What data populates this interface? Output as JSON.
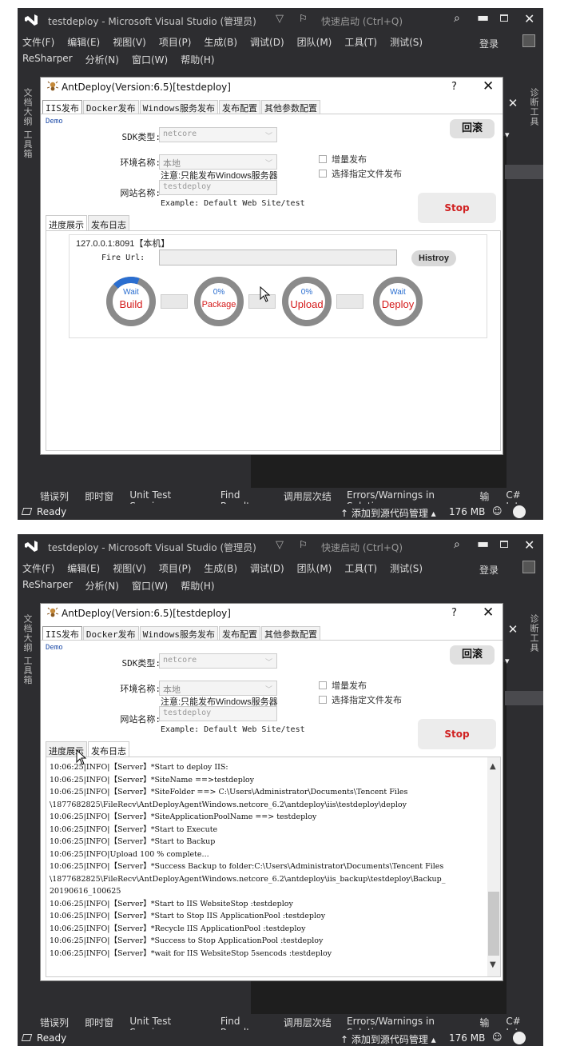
{
  "vs": {
    "title": "testdeploy - Microsoft Visual Studio (管理员)",
    "quick_launch": "快速启动 (Ctrl+Q)",
    "menu1": [
      "文件(F)",
      "编辑(E)",
      "视图(V)",
      "项目(P)",
      "生成(B)",
      "调试(D)",
      "团队(M)",
      "工具(T)",
      "测试(S)"
    ],
    "login": "登录",
    "menu2": [
      "ReSharper",
      "分析(N)",
      "窗口(W)",
      "帮助(H)"
    ],
    "side_left": "文档大纲  工具箱",
    "side_right": "诊断工具",
    "bottom_tabs": [
      "错误列表",
      "即时窗口",
      "Unit Test Sessions",
      "Find Results",
      "调用层次结构",
      "Errors/Warnings in Solution",
      "输出",
      "C# Int"
    ],
    "status_ready": "Ready",
    "status_source": "↑ 添加到源代码管理 ▴",
    "status_mem": "176 MB"
  },
  "dialog": {
    "title": "AntDeploy(Version:6.5)[testdeploy]",
    "help": "?",
    "close": "✕",
    "tabs": [
      "IIS发布",
      "Docker发布",
      "Windows服务发布",
      "发布配置",
      "其他参数配置"
    ],
    "demo": "Demo",
    "sdk_label": "SDK类型:",
    "sdk_value": "netcore",
    "env_label": "环境名称:",
    "env_value": "本地",
    "env_note": "注意:只能发布Windows服务器",
    "site_label": "网站名称:",
    "site_value": "testdeploy",
    "site_example": "Example: Default Web Site/test",
    "checkbox_incremental": "增量发布",
    "checkbox_select_files": "选择指定文件发布",
    "rollback_button": "回滚",
    "stop_button": "Stop",
    "subtabs": [
      "进度展示",
      "发布日志"
    ]
  },
  "progress": {
    "server": "127.0.0.1:8091【本机】",
    "fire_url_label": "Fire Url:",
    "fire_url_value": "",
    "history_button": "Histroy",
    "steps": [
      {
        "top": "Wait",
        "bottom": "Build",
        "progress": 0.18
      },
      {
        "top": "0%",
        "bottom": "Package",
        "progress": 0
      },
      {
        "top": "0%",
        "bottom": "Upload",
        "progress": 0
      },
      {
        "top": "Wait",
        "bottom": "Deploy",
        "progress": 0
      }
    ]
  },
  "log": {
    "lines": [
      "10:06:25|INFO|【Server】*Start to deploy IIS:",
      "10:06:25|INFO|【Server】*SiteName ==>testdeploy",
      "10:06:25|INFO|【Server】*SiteFolder ==> C:\\Users\\Administrator\\Documents\\Tencent Files",
      "\\1877682825\\FileRecv\\AntDeployAgentWindows.netcore_6.2\\antdeploy\\iis\\testdeploy\\deploy",
      "10:06:25|INFO|【Server】*SiteApplicationPoolName ==> testdeploy",
      "10:06:25|INFO|【Server】*Start to Execute",
      "10:06:25|INFO|【Server】*Start to Backup",
      "10:06:25|INFO|Upload 100 % complete...",
      "10:06:25|INFO|【Server】*Success Backup to folder:C:\\Users\\Administrator\\Documents\\Tencent Files",
      "\\1877682825\\FileRecv\\AntDeployAgentWindows.netcore_6.2\\antdeploy\\iis_backup\\testdeploy\\Backup_",
      "20190616_100625",
      "10:06:25|INFO|【Server】*Start to IIS WebsiteStop :testdeploy",
      "10:06:25|INFO|【Server】*Start to Stop IIS ApplicationPool :testdeploy",
      "10:06:25|INFO|【Server】*Recycle IIS ApplicationPool :testdeploy",
      "10:06:25|INFO|【Server】*Success to Stop ApplicationPool :testdeploy",
      "10:06:25|INFO|【Server】*wait for IIS WebsiteStop 5sencods :testdeploy"
    ]
  },
  "colors": {
    "vs_bg": "#2d2d30",
    "progress_blue": "#2a6ed0",
    "ring_gray": "#8a8a8a",
    "stop_red": "#d02020",
    "step_red": "#d41a1a"
  }
}
